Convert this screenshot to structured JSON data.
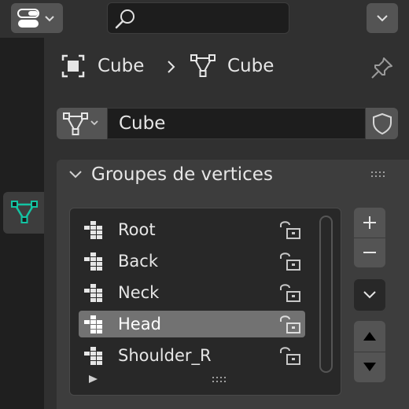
{
  "header": {
    "editor_type_icon": "properties-editor-icon",
    "search": {
      "value": "",
      "placeholder": ""
    },
    "menu_icon": "chevron-down-icon"
  },
  "tabs": [
    {
      "name": "mesh-data-tab",
      "icon": "vertex-triangle-icon",
      "active": true,
      "color": "#13c4a3"
    }
  ],
  "breadcrumb": {
    "items": [
      {
        "label": "Cube",
        "icon": "object-square-icon"
      },
      {
        "label": "Cube",
        "icon": "mesh-triangle-icon"
      }
    ],
    "separator_icon": "chevron-right-icon",
    "pin_icon": "pin-icon"
  },
  "datablock": {
    "type_icon": "mesh-triangle-icon",
    "name": "Cube",
    "fake_user_icon": "shield-icon"
  },
  "vertex_groups": {
    "title": "Groupes de vertices",
    "items": [
      {
        "label": "Root",
        "selected": false,
        "lock_icon": "unlock-icon"
      },
      {
        "label": "Back",
        "selected": false,
        "lock_icon": "unlock-icon"
      },
      {
        "label": "Neck",
        "selected": false,
        "lock_icon": "unlock-icon"
      },
      {
        "label": "Head",
        "selected": true,
        "lock_icon": "unlock-icon"
      },
      {
        "label": "Shoulder_R",
        "selected": false,
        "lock_icon": "unlock-icon"
      }
    ],
    "side_buttons": {
      "add_icon": "plus-icon",
      "remove_icon": "minus-icon",
      "specials_icon": "chevron-down-icon",
      "move_up_icon": "triangle-up-icon",
      "move_down_icon": "triangle-down-icon"
    }
  },
  "colors": {
    "accent": "#13c4a3",
    "selected_row": "#727272"
  }
}
